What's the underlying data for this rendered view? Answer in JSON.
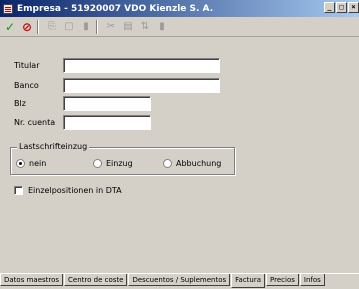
{
  "window": {
    "title": "Empresa - 51920007 VDO Kienzle S. A."
  },
  "form": {
    "titular_label": "Titular",
    "titular_value": "",
    "banco_label": "Banco",
    "banco_value": "",
    "blz_label": "Blz",
    "blz_value": "",
    "cuenta_label": "Nr. cuenta",
    "cuenta_value": ""
  },
  "lastschrift": {
    "legend": "Lastschrifteinzug",
    "options": [
      "nein",
      "Einzug",
      "Abbuchung"
    ],
    "selected": "nein"
  },
  "checkbox": {
    "label": "Einzelpositionen in DTA",
    "checked": false
  },
  "tabs": [
    "Datos maestros",
    "Centro de coste",
    "Descuentos / Suplementos",
    "Factura",
    "Precios",
    "Infos"
  ],
  "active_tab": "Factura"
}
